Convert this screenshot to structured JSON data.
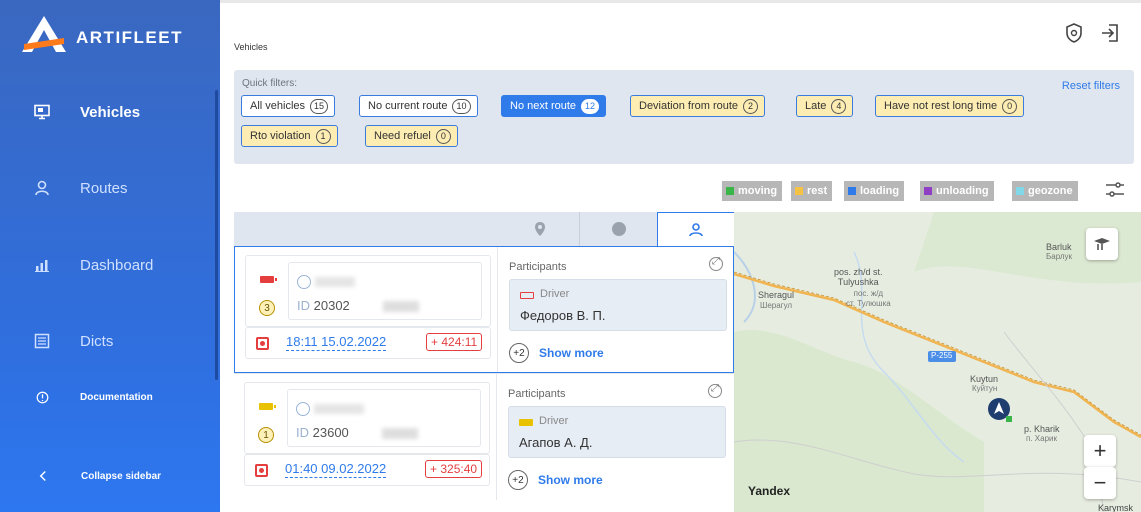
{
  "app": {
    "name": "ARTIFLEET"
  },
  "sidebar": {
    "items": [
      {
        "label": "Vehicles",
        "icon": "monitor-icon",
        "active": true
      },
      {
        "label": "Routes",
        "icon": "user-route-icon"
      },
      {
        "label": "Dashboard",
        "icon": "bar-chart-icon"
      },
      {
        "label": "Dicts",
        "icon": "list-icon"
      },
      {
        "label": "Documentation",
        "icon": "info-icon"
      },
      {
        "label": "Collapse sidebar",
        "icon": "chevron-left-icon"
      }
    ]
  },
  "header": {
    "title": "Vehicles"
  },
  "quick_filters": {
    "label": "Quick filters:",
    "reset": "Reset filters",
    "chips": [
      {
        "label": "All vehicles",
        "count": "15",
        "style": "white"
      },
      {
        "label": "No current route",
        "count": "10",
        "style": "white"
      },
      {
        "label": "No next route",
        "count": "12",
        "style": "blue",
        "selected": true
      },
      {
        "label": "Deviation from route",
        "count": "2",
        "style": "yellow"
      },
      {
        "label": "Late",
        "count": "4",
        "style": "yellow"
      },
      {
        "label": "Have not rest long time",
        "count": "0",
        "style": "yellow"
      },
      {
        "label": "Rto violation",
        "count": "1",
        "style": "yellow"
      },
      {
        "label": "Need refuel",
        "count": "0",
        "style": "yellow"
      }
    ]
  },
  "legend": [
    {
      "label": "moving",
      "color": "#3ab54a"
    },
    {
      "label": "rest",
      "color": "#f6c244"
    },
    {
      "label": "loading",
      "color": "#2f7bea"
    },
    {
      "label": "unloading",
      "color": "#8e3fc4"
    },
    {
      "label": "geozone",
      "color": "#80d8e8"
    }
  ],
  "vehicles": [
    {
      "level": "3",
      "id_label": "ID",
      "id": "20302",
      "battery_color": "#e53e3e",
      "time": "18:11 15.02.2022",
      "delay": "+ 424:11",
      "participants_title": "Participants",
      "driver_label": "Driver",
      "driver_name": "Федоров В. П.",
      "driver_battery": "#e53e3e",
      "more_count": "+2",
      "show_more": "Show more"
    },
    {
      "level": "1",
      "id_label": "ID",
      "id": "23600",
      "battery_color": "#e8c200",
      "time": "01:40 09.02.2022",
      "delay": "+ 325:40",
      "participants_title": "Participants",
      "driver_label": "Driver",
      "driver_name": "Агапов А. Д.",
      "driver_battery": "#e8c200",
      "more_count": "+2",
      "show_more": "Show more"
    }
  ],
  "map": {
    "labels": {
      "barluk": "Barluk",
      "barluk_ru": "Барлук",
      "tulyushka": "pos. zh/d st.\nTulyushka",
      "tulyushka_ru": "пос. ж/д\nст. Тулюшка",
      "sheragul": "Sheragul",
      "sheragul_ru": "Шерагул",
      "road": "P-255",
      "kuytun": "Kuytun",
      "kuytun_ru": "Куйтун",
      "kharik": "p. Kharik",
      "kharik_ru": "п. Харик",
      "yandex": "Yandex",
      "karymsk": "Karymsk"
    },
    "zoom_in": "+",
    "zoom_out": "−"
  }
}
